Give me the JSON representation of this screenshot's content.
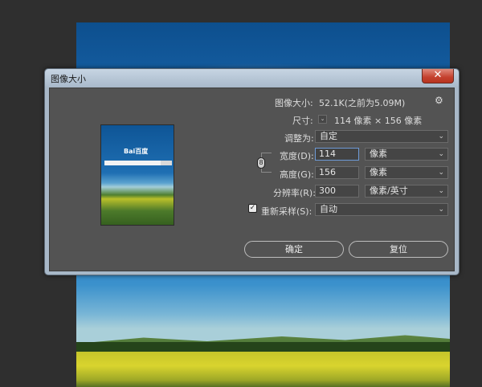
{
  "dialog": {
    "title": "图像大小",
    "close_glyph": "✕",
    "gear_glyph": "⚙",
    "check_glyph": "✓",
    "chain_glyph": "8",
    "dropdown_glyph": "⌄"
  },
  "preview": {
    "logo_text": "Bai百度"
  },
  "image_size": {
    "label": "图像大小:",
    "value": "52.1K(之前为5.09M)"
  },
  "dimensions": {
    "label": "尺寸:",
    "value": "114 像素 × 156 像素"
  },
  "fit_to": {
    "label": "调整为:",
    "selected": "自定"
  },
  "width": {
    "label": "宽度(D):",
    "value": "114",
    "unit": "像素"
  },
  "height": {
    "label": "高度(G):",
    "value": "156",
    "unit": "像素"
  },
  "resolution": {
    "label": "分辨率(R):",
    "value": "300",
    "unit": "像素/英寸"
  },
  "resample": {
    "label": "重新采样(S):",
    "checked": true,
    "selected": "自动"
  },
  "buttons": {
    "ok": "确定",
    "reset": "复位"
  }
}
